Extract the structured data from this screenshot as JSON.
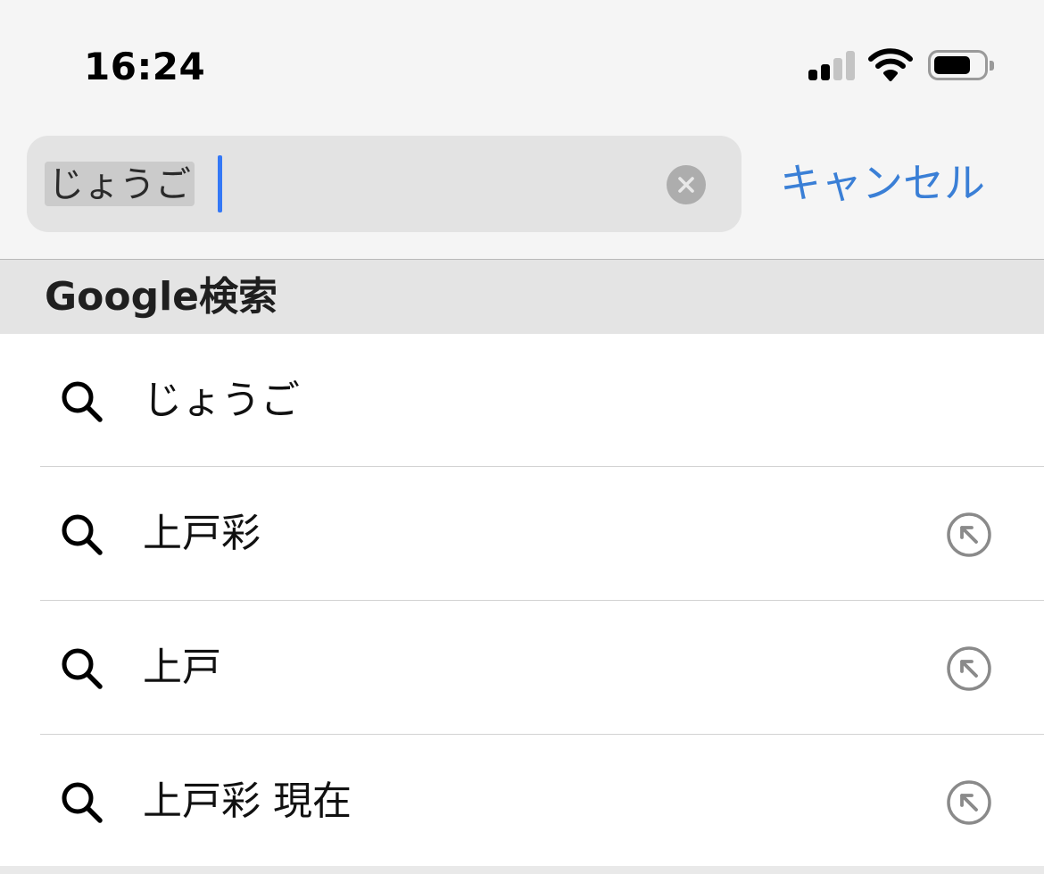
{
  "status_bar": {
    "time": "16:24",
    "signal_icon": "cellular-signal-icon",
    "wifi_icon": "wifi-icon",
    "battery_icon": "battery-icon"
  },
  "search": {
    "query": "じょうご",
    "clear_icon": "clear-x-icon",
    "cancel_label": "キャンセル"
  },
  "section": {
    "title": "Google検索"
  },
  "suggestions": [
    {
      "label": "じょうご",
      "icon": "search-icon",
      "has_fill_button": false
    },
    {
      "label": "上戸彩",
      "icon": "search-icon",
      "has_fill_button": true
    },
    {
      "label": "上戸",
      "icon": "search-icon",
      "has_fill_button": true
    },
    {
      "label": "上戸彩 現在",
      "icon": "search-icon",
      "has_fill_button": true
    }
  ],
  "colors": {
    "accent": "#3a7fd6",
    "caret": "#3478f6",
    "header_bg": "#f5f5f5",
    "section_bg": "#e4e4e4",
    "field_bg": "#e3e3e3"
  }
}
